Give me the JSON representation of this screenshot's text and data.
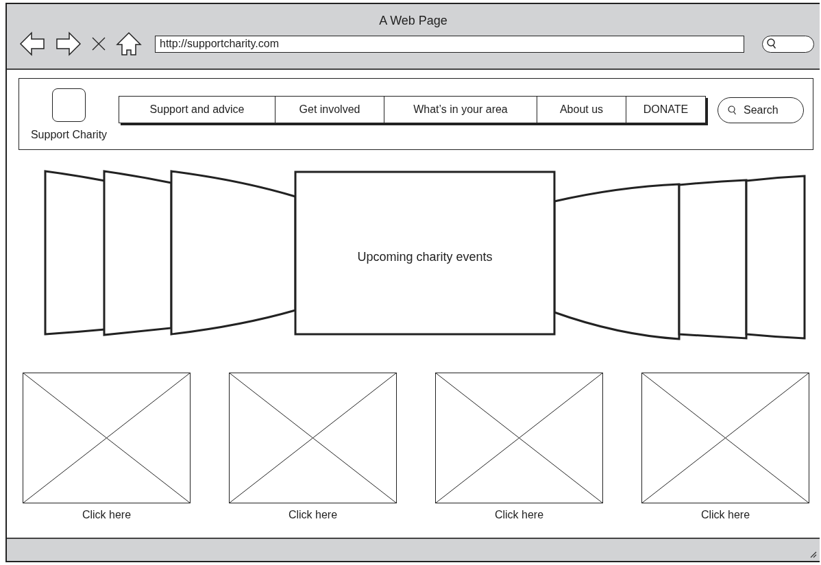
{
  "window": {
    "title": "A Web Page"
  },
  "toolbar": {
    "address": "http://supportcharity.com"
  },
  "site": {
    "name": "Support Charity"
  },
  "nav": [
    {
      "label": "Support and advice"
    },
    {
      "label": "Get involved"
    },
    {
      "label": "What’s in your area"
    },
    {
      "label": "About us"
    },
    {
      "label": "DONATE"
    }
  ],
  "search": {
    "label": "Search"
  },
  "carousel": {
    "title": "Upcoming charity events"
  },
  "cards": [
    {
      "caption": "Click here"
    },
    {
      "caption": "Click here"
    },
    {
      "caption": "Click here"
    },
    {
      "caption": "Click here"
    }
  ]
}
